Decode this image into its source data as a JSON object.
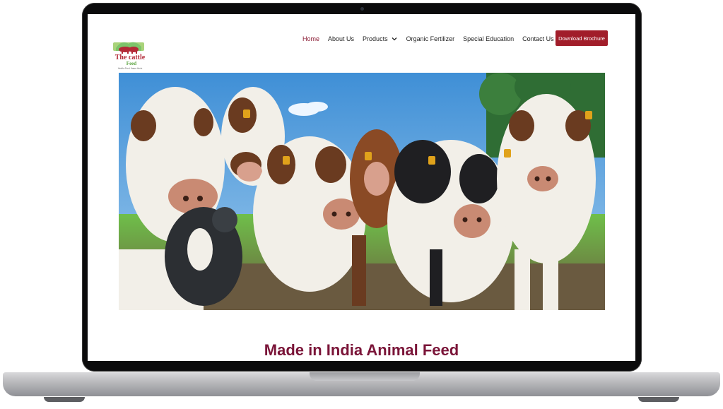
{
  "logo": {
    "line1": "The cattle",
    "line2": "Feed",
    "tagline": "Healthy Feed, Happy Herds"
  },
  "nav": {
    "items": [
      {
        "label": "Home",
        "active": true
      },
      {
        "label": "About Us"
      },
      {
        "label": "Products",
        "dropdown": true
      },
      {
        "label": "Organic Fertilizer"
      },
      {
        "label": "Special Education"
      },
      {
        "label": "Contact Us"
      }
    ],
    "cta": "Download Brochure"
  },
  "hero": {
    "icon": "cows-photo"
  },
  "headline": "Made in India Animal Feed",
  "colors": {
    "brand": "#a11d2a",
    "headline": "#7a1438"
  }
}
